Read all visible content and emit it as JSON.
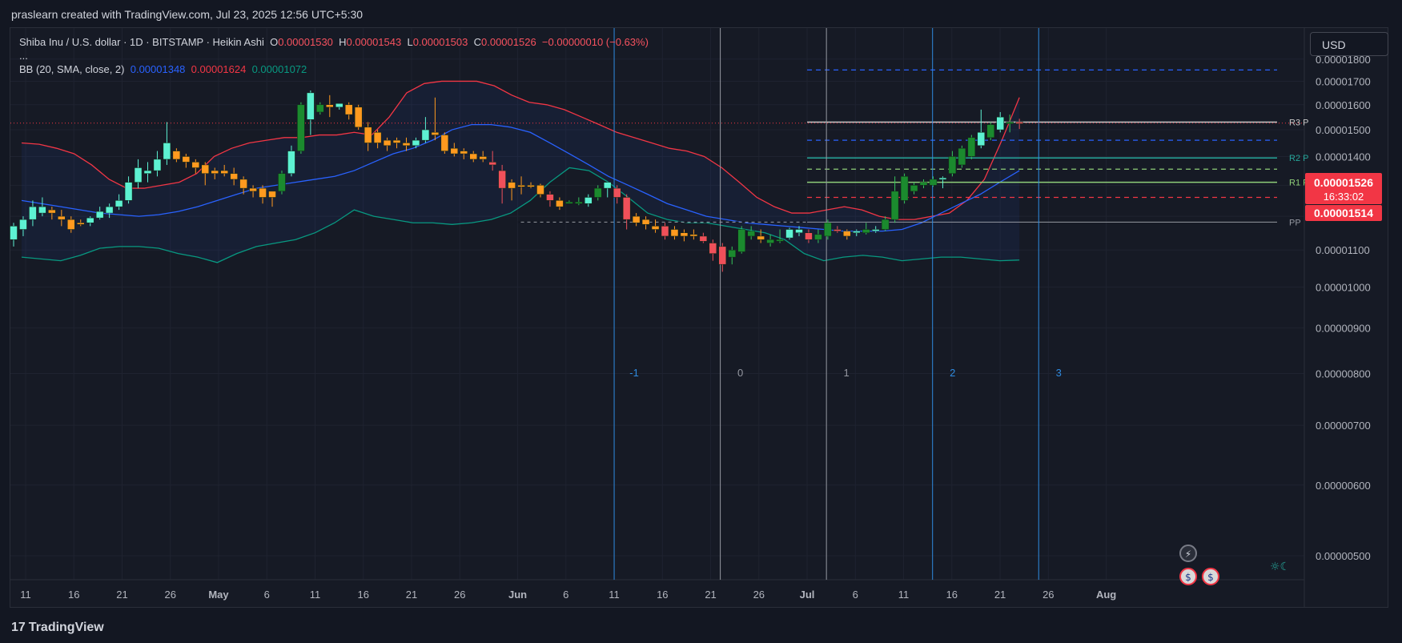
{
  "header": {
    "credit": "praslearn created with TradingView.com, Jul 23, 2025 12:56 UTC+5:30"
  },
  "legend": {
    "symbol": "Shiba Inu / U.S. dollar · 1D · BITSTAMP · Heikin Ashi",
    "o_label": "O",
    "o_value": "0.00001530",
    "h_label": "H",
    "h_value": "0.00001543",
    "l_label": "L",
    "l_value": "0.00001503",
    "c_label": "C",
    "c_value": "0.00001526",
    "change": "−0.00000010 (−0.63%)",
    "ellipsis": "...",
    "bb_label": "BB (20, SMA, close, 2)",
    "bb_basis": "0.00001348",
    "bb_upper": "0.00001624",
    "bb_lower": "0.00001072"
  },
  "currency_button": "USD",
  "price_tags": {
    "last_price": "0.00001526",
    "countdown": "16:33:02",
    "secondary_price": "0.00001514"
  },
  "footer": {
    "brand": "TradingView",
    "brand_mark": "17"
  },
  "colors": {
    "bg": "#161a25",
    "grid": "#1f2330",
    "up_bright": "#5df1d2",
    "up_dark": "#1b8a2e",
    "down_orange": "#ff9a1f",
    "down_red": "#f0505a",
    "bb_upper": "#f23645",
    "bb_basis": "#2962ff",
    "bb_lower": "#089981",
    "vline_blue": "#2f8be0",
    "vline_gray": "#9598a1"
  },
  "chart_data": {
    "type": "candlestick",
    "title": "Shiba Inu / U.S. dollar · 1D · BITSTAMP · Heikin Ashi",
    "y_axis": {
      "scale": "log",
      "range": [
        4.7e-06,
        1.95e-05
      ],
      "ticks": [
        "0.00001800",
        "0.00001700",
        "0.00001600",
        "0.00001500",
        "0.00001400",
        "0.00001300",
        "0.00001200",
        "0.00001100",
        "0.00001000",
        "0.00000900",
        "0.00000800",
        "0.00000700",
        "0.00000600",
        "0.00000500"
      ]
    },
    "x_axis": {
      "ticks": [
        {
          "label": "11",
          "bold": false,
          "date": "2025-04-11"
        },
        {
          "label": "16",
          "bold": false,
          "date": "2025-04-16"
        },
        {
          "label": "21",
          "bold": false,
          "date": "2025-04-21"
        },
        {
          "label": "26",
          "bold": false,
          "date": "2025-04-26"
        },
        {
          "label": "May",
          "bold": true,
          "date": "2025-05-01"
        },
        {
          "label": "6",
          "bold": false,
          "date": "2025-05-06"
        },
        {
          "label": "11",
          "bold": false,
          "date": "2025-05-11"
        },
        {
          "label": "16",
          "bold": false,
          "date": "2025-05-16"
        },
        {
          "label": "21",
          "bold": false,
          "date": "2025-05-21"
        },
        {
          "label": "26",
          "bold": false,
          "date": "2025-05-26"
        },
        {
          "label": "Jun",
          "bold": true,
          "date": "2025-06-01"
        },
        {
          "label": "6",
          "bold": false,
          "date": "2025-06-06"
        },
        {
          "label": "11",
          "bold": false,
          "date": "2025-06-11"
        },
        {
          "label": "16",
          "bold": false,
          "date": "2025-06-16"
        },
        {
          "label": "21",
          "bold": false,
          "date": "2025-06-21"
        },
        {
          "label": "26",
          "bold": false,
          "date": "2025-06-26"
        },
        {
          "label": "Jul",
          "bold": true,
          "date": "2025-07-01"
        },
        {
          "label": "6",
          "bold": false,
          "date": "2025-07-06"
        },
        {
          "label": "11",
          "bold": false,
          "date": "2025-07-11"
        },
        {
          "label": "16",
          "bold": false,
          "date": "2025-07-16"
        },
        {
          "label": "21",
          "bold": false,
          "date": "2025-07-21"
        },
        {
          "label": "26",
          "bold": false,
          "date": "2025-07-26"
        },
        {
          "label": "Aug",
          "bold": true,
          "date": "2025-08-01"
        }
      ]
    },
    "candles": [
      {
        "o": 11.3,
        "h": 11.8,
        "l": 11.1,
        "c": 11.7,
        "k": "ub"
      },
      {
        "o": 11.6,
        "h": 12.0,
        "l": 11.4,
        "c": 11.9,
        "k": "ub"
      },
      {
        "o": 11.9,
        "h": 12.5,
        "l": 11.7,
        "c": 12.3,
        "k": "ub"
      },
      {
        "o": 12.3,
        "h": 12.6,
        "l": 12.0,
        "c": 12.1,
        "k": "ub"
      },
      {
        "o": 12.2,
        "h": 12.3,
        "l": 11.9,
        "c": 12.1,
        "k": "do"
      },
      {
        "o": 12.0,
        "h": 12.2,
        "l": 11.7,
        "c": 11.9,
        "k": "do"
      },
      {
        "o": 11.9,
        "h": 12.0,
        "l": 11.5,
        "c": 11.6,
        "k": "do"
      },
      {
        "o": 11.8,
        "h": 11.9,
        "l": 11.7,
        "c": 11.8,
        "k": "do"
      },
      {
        "o": 11.8,
        "h": 12.0,
        "l": 11.7,
        "c": 11.95,
        "k": "ub"
      },
      {
        "o": 11.95,
        "h": 12.3,
        "l": 11.9,
        "c": 12.15,
        "k": "ub"
      },
      {
        "o": 12.1,
        "h": 12.4,
        "l": 11.95,
        "c": 12.3,
        "k": "ub"
      },
      {
        "o": 12.3,
        "h": 12.7,
        "l": 12.2,
        "c": 12.5,
        "k": "ub"
      },
      {
        "o": 12.5,
        "h": 13.3,
        "l": 12.4,
        "c": 13.1,
        "k": "ub"
      },
      {
        "o": 13.1,
        "h": 13.9,
        "l": 12.9,
        "c": 13.6,
        "k": "ub"
      },
      {
        "o": 13.4,
        "h": 13.8,
        "l": 13.1,
        "c": 13.5,
        "k": "ub"
      },
      {
        "o": 13.5,
        "h": 14.2,
        "l": 13.3,
        "c": 13.9,
        "k": "ub"
      },
      {
        "o": 13.9,
        "h": 15.3,
        "l": 13.7,
        "c": 14.5,
        "k": "ub"
      },
      {
        "o": 14.2,
        "h": 14.3,
        "l": 13.8,
        "c": 13.9,
        "k": "do"
      },
      {
        "o": 14.0,
        "h": 14.1,
        "l": 13.6,
        "c": 13.8,
        "k": "do"
      },
      {
        "o": 13.8,
        "h": 13.9,
        "l": 13.4,
        "c": 13.6,
        "k": "do"
      },
      {
        "o": 13.7,
        "h": 13.8,
        "l": 13.0,
        "c": 13.4,
        "k": "do"
      },
      {
        "o": 13.4,
        "h": 13.6,
        "l": 13.2,
        "c": 13.5,
        "k": "do"
      },
      {
        "o": 13.5,
        "h": 13.7,
        "l": 13.3,
        "c": 13.4,
        "k": "do"
      },
      {
        "o": 13.4,
        "h": 13.6,
        "l": 13.0,
        "c": 13.2,
        "k": "do"
      },
      {
        "o": 13.2,
        "h": 13.3,
        "l": 12.7,
        "c": 12.9,
        "k": "do"
      },
      {
        "o": 12.9,
        "h": 13.0,
        "l": 12.6,
        "c": 12.8,
        "k": "do"
      },
      {
        "o": 12.9,
        "h": 13.0,
        "l": 12.4,
        "c": 12.6,
        "k": "do"
      },
      {
        "o": 12.6,
        "h": 12.8,
        "l": 12.3,
        "c": 12.8,
        "k": "do"
      },
      {
        "o": 12.8,
        "h": 13.5,
        "l": 12.7,
        "c": 13.4,
        "k": "ug"
      },
      {
        "o": 13.4,
        "h": 14.4,
        "l": 13.3,
        "c": 14.2,
        "k": "ub"
      },
      {
        "o": 14.2,
        "h": 16.1,
        "l": 14.1,
        "c": 16.0,
        "k": "ug"
      },
      {
        "o": 15.4,
        "h": 16.6,
        "l": 14.8,
        "c": 16.5,
        "k": "ub"
      },
      {
        "o": 16.0,
        "h": 16.1,
        "l": 15.6,
        "c": 15.7,
        "k": "ug"
      },
      {
        "o": 15.9,
        "h": 16.4,
        "l": 15.5,
        "c": 16.0,
        "k": "do"
      },
      {
        "o": 15.9,
        "h": 16.0,
        "l": 15.8,
        "c": 16.05,
        "k": "ub"
      },
      {
        "o": 16.0,
        "h": 16.1,
        "l": 15.4,
        "c": 15.6,
        "k": "do"
      },
      {
        "o": 15.9,
        "h": 16.0,
        "l": 15.0,
        "c": 15.1,
        "k": "do"
      },
      {
        "o": 15.1,
        "h": 15.3,
        "l": 14.2,
        "c": 14.5,
        "k": "do"
      },
      {
        "o": 14.9,
        "h": 15.0,
        "l": 14.3,
        "c": 14.5,
        "k": "do"
      },
      {
        "o": 14.6,
        "h": 14.7,
        "l": 14.2,
        "c": 14.4,
        "k": "do"
      },
      {
        "o": 14.6,
        "h": 14.7,
        "l": 14.3,
        "c": 14.5,
        "k": "do"
      },
      {
        "o": 14.5,
        "h": 14.7,
        "l": 14.2,
        "c": 14.4,
        "k": "do"
      },
      {
        "o": 14.4,
        "h": 14.7,
        "l": 14.3,
        "c": 14.6,
        "k": "ub"
      },
      {
        "o": 14.6,
        "h": 15.5,
        "l": 14.5,
        "c": 15.0,
        "k": "ub"
      },
      {
        "o": 14.9,
        "h": 16.3,
        "l": 14.6,
        "c": 14.8,
        "k": "do"
      },
      {
        "o": 14.8,
        "h": 14.9,
        "l": 14.1,
        "c": 14.2,
        "k": "do"
      },
      {
        "o": 14.3,
        "h": 14.5,
        "l": 14.0,
        "c": 14.1,
        "k": "do"
      },
      {
        "o": 14.2,
        "h": 14.3,
        "l": 13.9,
        "c": 14.1,
        "k": "do"
      },
      {
        "o": 14.1,
        "h": 14.2,
        "l": 13.8,
        "c": 13.9,
        "k": "do"
      },
      {
        "o": 14.0,
        "h": 14.2,
        "l": 13.8,
        "c": 13.9,
        "k": "do"
      },
      {
        "o": 13.8,
        "h": 14.2,
        "l": 13.5,
        "c": 13.7,
        "k": "dr"
      },
      {
        "o": 13.5,
        "h": 13.7,
        "l": 12.4,
        "c": 12.9,
        "k": "dr"
      },
      {
        "o": 13.1,
        "h": 13.2,
        "l": 12.5,
        "c": 12.9,
        "k": "do"
      },
      {
        "o": 13.0,
        "h": 13.3,
        "l": 12.7,
        "c": 13.0,
        "k": "do"
      },
      {
        "o": 13.0,
        "h": 13.1,
        "l": 12.9,
        "c": 13.0,
        "k": "do"
      },
      {
        "o": 13.0,
        "h": 13.05,
        "l": 12.6,
        "c": 12.7,
        "k": "do"
      },
      {
        "o": 12.7,
        "h": 12.8,
        "l": 12.3,
        "c": 12.5,
        "k": "dr"
      },
      {
        "o": 12.5,
        "h": 12.6,
        "l": 12.2,
        "c": 12.3,
        "k": "do"
      },
      {
        "o": 12.45,
        "h": 12.5,
        "l": 12.4,
        "c": 12.45,
        "k": "ug"
      },
      {
        "o": 12.4,
        "h": 12.6,
        "l": 12.35,
        "c": 12.45,
        "k": "ug"
      },
      {
        "o": 12.4,
        "h": 12.7,
        "l": 12.3,
        "c": 12.6,
        "k": "ub"
      },
      {
        "o": 12.6,
        "h": 13.0,
        "l": 12.5,
        "c": 12.9,
        "k": "ug"
      },
      {
        "o": 12.9,
        "h": 13.1,
        "l": 12.6,
        "c": 13.1,
        "k": "ub"
      },
      {
        "o": 12.9,
        "h": 13.0,
        "l": 12.4,
        "c": 12.6,
        "k": "dr"
      },
      {
        "o": 12.6,
        "h": 12.7,
        "l": 11.6,
        "c": 11.9,
        "k": "dr"
      },
      {
        "o": 12.0,
        "h": 12.1,
        "l": 11.7,
        "c": 11.8,
        "k": "do"
      },
      {
        "o": 11.9,
        "h": 12.0,
        "l": 11.6,
        "c": 11.75,
        "k": "do"
      },
      {
        "o": 11.7,
        "h": 11.9,
        "l": 11.5,
        "c": 11.6,
        "k": "do"
      },
      {
        "o": 11.7,
        "h": 11.8,
        "l": 11.3,
        "c": 11.4,
        "k": "dr"
      },
      {
        "o": 11.6,
        "h": 11.7,
        "l": 11.3,
        "c": 11.4,
        "k": "do"
      },
      {
        "o": 11.5,
        "h": 11.6,
        "l": 11.25,
        "c": 11.4,
        "k": "do"
      },
      {
        "o": 11.45,
        "h": 11.6,
        "l": 11.3,
        "c": 11.4,
        "k": "do"
      },
      {
        "o": 11.4,
        "h": 11.5,
        "l": 11.2,
        "c": 11.25,
        "k": "dr"
      },
      {
        "o": 11.2,
        "h": 11.3,
        "l": 10.7,
        "c": 10.9,
        "k": "dr"
      },
      {
        "o": 11.1,
        "h": 11.2,
        "l": 10.4,
        "c": 10.6,
        "k": "dr"
      },
      {
        "o": 10.8,
        "h": 11.1,
        "l": 10.6,
        "c": 11.0,
        "k": "ug"
      },
      {
        "o": 10.95,
        "h": 11.7,
        "l": 10.9,
        "c": 11.6,
        "k": "ug"
      },
      {
        "o": 11.4,
        "h": 11.7,
        "l": 11.3,
        "c": 11.55,
        "k": "ug"
      },
      {
        "o": 11.4,
        "h": 11.6,
        "l": 11.2,
        "c": 11.3,
        "k": "do"
      },
      {
        "o": 11.3,
        "h": 11.45,
        "l": 11.1,
        "c": 11.2,
        "k": "ug"
      },
      {
        "o": 11.3,
        "h": 11.6,
        "l": 11.2,
        "c": 11.3,
        "k": "ug"
      },
      {
        "o": 11.35,
        "h": 11.65,
        "l": 11.3,
        "c": 11.6,
        "k": "ub"
      },
      {
        "o": 11.6,
        "h": 11.7,
        "l": 11.4,
        "c": 11.5,
        "k": "ub"
      },
      {
        "o": 11.5,
        "h": 11.6,
        "l": 11.2,
        "c": 11.3,
        "k": "dr"
      },
      {
        "o": 11.3,
        "h": 11.6,
        "l": 11.2,
        "c": 11.45,
        "k": "ug"
      },
      {
        "o": 11.4,
        "h": 11.9,
        "l": 11.3,
        "c": 11.8,
        "k": "ug"
      },
      {
        "o": 11.6,
        "h": 11.7,
        "l": 11.5,
        "c": 11.55,
        "k": "dr"
      },
      {
        "o": 11.55,
        "h": 11.6,
        "l": 11.3,
        "c": 11.4,
        "k": "do"
      },
      {
        "o": 11.5,
        "h": 11.6,
        "l": 11.4,
        "c": 11.55,
        "k": "ub"
      },
      {
        "o": 11.5,
        "h": 11.8,
        "l": 11.45,
        "c": 11.6,
        "k": "ug"
      },
      {
        "o": 11.6,
        "h": 11.7,
        "l": 11.5,
        "c": 11.6,
        "k": "ub"
      },
      {
        "o": 11.6,
        "h": 12.0,
        "l": 11.55,
        "c": 11.9,
        "k": "ug"
      },
      {
        "o": 11.9,
        "h": 13.3,
        "l": 11.8,
        "c": 12.8,
        "k": "ug"
      },
      {
        "o": 12.5,
        "h": 13.4,
        "l": 12.4,
        "c": 13.3,
        "k": "ug"
      },
      {
        "o": 12.8,
        "h": 13.1,
        "l": 12.7,
        "c": 13.0,
        "k": "ug"
      },
      {
        "o": 13.0,
        "h": 13.2,
        "l": 12.9,
        "c": 13.1,
        "k": "ug"
      },
      {
        "o": 13.0,
        "h": 13.3,
        "l": 12.95,
        "c": 13.2,
        "k": "ug"
      },
      {
        "o": 13.2,
        "h": 13.3,
        "l": 12.9,
        "c": 13.25,
        "k": "ub"
      },
      {
        "o": 13.4,
        "h": 14.2,
        "l": 13.3,
        "c": 14.0,
        "k": "ug"
      },
      {
        "o": 13.7,
        "h": 14.4,
        "l": 13.6,
        "c": 14.3,
        "k": "ug"
      },
      {
        "o": 14.0,
        "h": 14.8,
        "l": 13.9,
        "c": 14.7,
        "k": "ug"
      },
      {
        "o": 14.4,
        "h": 15.8,
        "l": 14.3,
        "c": 14.9,
        "k": "ub"
      },
      {
        "o": 14.7,
        "h": 15.3,
        "l": 14.6,
        "c": 15.2,
        "k": "ug"
      },
      {
        "o": 15.0,
        "h": 15.7,
        "l": 14.9,
        "c": 15.5,
        "k": "ub"
      },
      {
        "o": 15.3,
        "h": 15.6,
        "l": 14.9,
        "c": 15.3,
        "k": "ug"
      },
      {
        "o": 15.3,
        "h": 15.43,
        "l": 15.03,
        "c": 15.26,
        "k": "dr"
      }
    ],
    "bollinger": {
      "label": "BB (20, SMA, close, 2)",
      "upper_last": 16.24,
      "basis_last": 13.48,
      "lower_last": 10.72,
      "upper": [
        14.5,
        14.45,
        14.3,
        14.1,
        13.7,
        13.2,
        12.9,
        12.9,
        13.0,
        13.1,
        13.4,
        14.0,
        14.3,
        14.5,
        14.6,
        14.7,
        14.7,
        14.8,
        14.8,
        14.9,
        14.8,
        15.5,
        16.5,
        16.9,
        17.0,
        17.0,
        17.0,
        16.8,
        16.4,
        16.1,
        16.0,
        15.8,
        15.5,
        15.2,
        14.9,
        14.7,
        14.5,
        14.3,
        14.2,
        14.0,
        13.6,
        13.1,
        12.6,
        12.3,
        12.1,
        12.1,
        12.2,
        12.3,
        12.2,
        12.0,
        11.9,
        11.9,
        12.0,
        12.1,
        12.5,
        13.2,
        14.6,
        16.3
      ],
      "basis": [
        12.5,
        12.4,
        12.3,
        12.2,
        12.1,
        12.05,
        12.0,
        12.05,
        12.15,
        12.3,
        12.5,
        12.7,
        12.9,
        13.0,
        13.1,
        13.2,
        13.3,
        13.5,
        13.8,
        14.1,
        14.3,
        14.6,
        15.0,
        15.2,
        15.2,
        15.1,
        14.9,
        14.5,
        14.1,
        13.7,
        13.3,
        13.0,
        12.7,
        12.4,
        12.2,
        12.0,
        11.9,
        11.8,
        11.75,
        11.7,
        11.65,
        11.6,
        11.55,
        11.55,
        11.55,
        11.6,
        11.8,
        12.1,
        12.4,
        12.7,
        13.1,
        13.5
      ],
      "lower": [
        10.8,
        10.75,
        10.7,
        10.85,
        11.05,
        11.1,
        11.1,
        11.05,
        10.9,
        10.8,
        10.65,
        10.9,
        11.1,
        11.2,
        11.3,
        11.5,
        11.8,
        12.2,
        12.0,
        11.9,
        11.8,
        11.8,
        11.75,
        11.8,
        11.9,
        12.1,
        12.5,
        13.1,
        13.6,
        13.5,
        13.1,
        12.6,
        12.1,
        11.9,
        11.8,
        11.8,
        11.7,
        11.6,
        11.5,
        11.3,
        10.9,
        10.7,
        10.8,
        10.85,
        10.8,
        10.7,
        10.75,
        10.8,
        10.8,
        10.75,
        10.7,
        10.72
      ]
    },
    "vertical_lines": [
      {
        "date": "2025-06-11",
        "color": "blue",
        "label": "-1"
      },
      {
        "date": "2025-06-22",
        "color": "gray",
        "label": "0"
      },
      {
        "date": "2025-07-03",
        "color": "gray",
        "label": "1"
      },
      {
        "date": "2025-07-14",
        "color": "blue",
        "label": "2"
      },
      {
        "date": "2025-07-25",
        "color": "blue",
        "label": "3"
      }
    ],
    "pivots": {
      "PP": 11.82,
      "R1": 13.1,
      "R2": 13.95,
      "R3": 15.3,
      "labels": {
        "PP": "PP",
        "R1": "R1 P",
        "R2": "R2 P",
        "R3": "R3 P"
      },
      "dashed_levels": [
        17.5,
        14.6,
        13.55,
        12.6
      ]
    }
  }
}
